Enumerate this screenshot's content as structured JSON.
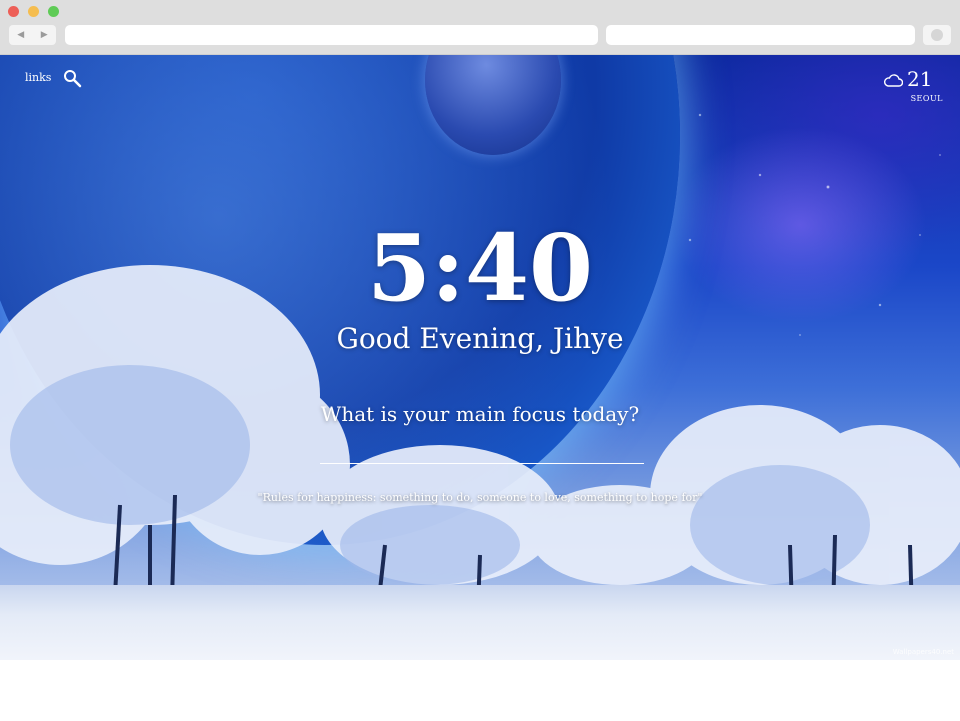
{
  "browser": {
    "nav_back_icon": "chevron-left-icon",
    "nav_forward_icon": "chevron-right-icon"
  },
  "overlay": {
    "links_label": "links",
    "search_icon": "search-icon",
    "weather": {
      "icon": "cloud-icon",
      "temperature": "21",
      "city": "SEOUL"
    },
    "clock": "5:40",
    "greeting": "Good Evening, Jihye",
    "focus_question": "What is your main focus today?",
    "focus_value": "",
    "quote": "\"Rules for happiness: something to do, someone to love, something to hope for\""
  },
  "wallpaper": {
    "watermark": "Wallpapers40.net"
  },
  "colors": {
    "sky_top": "#0b2a9e",
    "sky_mid": "#3d6fd8",
    "snow": "#f1f4fb",
    "text": "#ffffff"
  }
}
